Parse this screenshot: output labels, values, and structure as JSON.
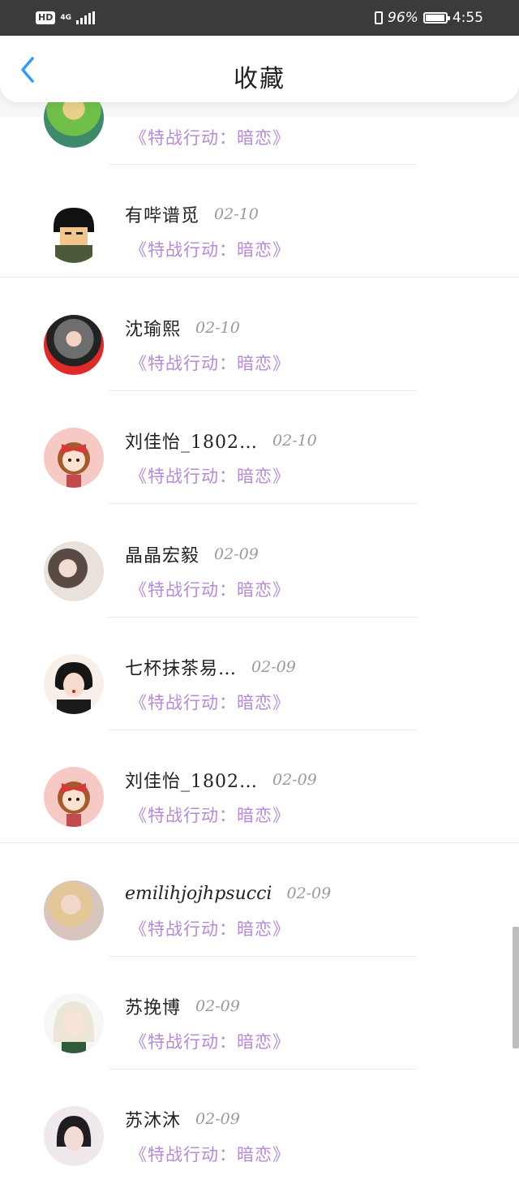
{
  "status_bar": {
    "hd": "HD",
    "network": "4G",
    "battery_percent": "96%",
    "battery_level": 0.96,
    "time": "4:55"
  },
  "header": {
    "title": "收藏",
    "back_icon": "chevron-left-icon",
    "accent": "#2e9bff"
  },
  "work_color": "#b58ad6",
  "items": [
    {
      "name": "",
      "date": "",
      "work": "《特战行动：暗恋》",
      "avatar": "green-outfit-avatar"
    },
    {
      "name": "有哔谱觅",
      "date": "02-10",
      "work": "《特战行动：暗恋》",
      "avatar": "cartoon-boy-avatar"
    },
    {
      "name": "沈瑜熙",
      "date": "02-10",
      "work": "《特战行动：暗恋》",
      "avatar": "woman-red-background-avatar"
    },
    {
      "name": "刘佳怡_1802…",
      "date": "02-10",
      "work": "《特战行动：暗恋》",
      "avatar": "cartoon-girl-bow-avatar"
    },
    {
      "name": "晶晶宏毅",
      "date": "02-09",
      "work": "《特战行动：暗恋》",
      "avatar": "couple-photo-avatar"
    },
    {
      "name": "七杯抹茶易…",
      "date": "02-09",
      "work": "《特战行动：暗恋》",
      "avatar": "illustrated-woman-black-hair-avatar"
    },
    {
      "name": "刘佳怡_1802…",
      "date": "02-09",
      "work": "《特战行动：暗恋》",
      "avatar": "cartoon-girl-bow-avatar"
    },
    {
      "name": "emilihjojhpsucci",
      "date": "02-09",
      "work": "《特战行动：暗恋》",
      "avatar": "blonde-woman-avatar"
    },
    {
      "name": "苏挽博",
      "date": "02-09",
      "work": "《特战行动：暗恋》",
      "avatar": "anime-white-hair-avatar"
    },
    {
      "name": "苏沐沐",
      "date": "02-09",
      "work": "《特战行动：暗恋》",
      "avatar": "illustrated-woman-avatar"
    }
  ]
}
